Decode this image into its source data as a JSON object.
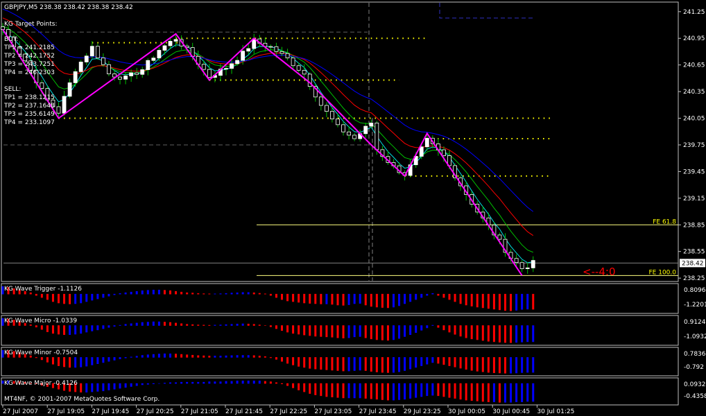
{
  "header": "GBPJPY,M5  238.38 238.42 238.38 238.42",
  "target_points": {
    "title": "KG Target Points:",
    "buy_label": "BUY:",
    "buy": [
      "TP1 = 241.2185",
      "TP2 = 242.1752",
      "TP3 = 243.7251",
      "TP4 = 246.2303"
    ],
    "sell_label": "SELL:",
    "sell": [
      "TP1 = 238.1215",
      "TP2 = 237.1648",
      "TP3 = 235.6149",
      "TP4 = 233.1097"
    ]
  },
  "annotation": "<--4:0",
  "copyright": "MT4NF, © 2001-2007 MetaQuotes Software Corp.",
  "colors": {
    "bull": "#ffffff",
    "bear": "#ffffff",
    "zigzag": "#ff00ff",
    "ma_blue": "#0000ff",
    "ma_red": "#ff0000",
    "ma_green": "#00c000",
    "ma_aqua": "#00e0e0",
    "target_dots": "#ffff00",
    "fib": "#ffff80",
    "grid": "#808080",
    "hist_red": "#ff0000",
    "hist_blue": "#0000ff",
    "annotation": "#ff0000"
  },
  "chart_data": [
    {
      "type": "candlestick",
      "title": "GBPJPY,M5",
      "ylim": [
        238.22,
        241.35
      ],
      "yticks": [
        241.25,
        240.95,
        240.65,
        240.35,
        240.05,
        239.75,
        239.45,
        239.15,
        238.85,
        238.55,
        238.25
      ],
      "current_price": 238.42,
      "xticks": [
        "27 Jul 2007",
        "27 Jul 19:05",
        "27 Jul 19:45",
        "27 Jul 20:25",
        "27 Jul 21:05",
        "27 Jul 21:45",
        "27 Jul 22:25",
        "27 Jul 23:05",
        "27 Jul 23:45",
        "29 Jul 23:25",
        "30 Jul 00:05",
        "30 Jul 00:45",
        "30 Jul 01:25"
      ],
      "zigzag": [
        [
          0,
          241.05
        ],
        [
          10,
          240.05
        ],
        [
          31,
          241.0
        ],
        [
          37,
          240.48
        ],
        [
          45,
          240.95
        ],
        [
          55,
          240.45
        ],
        [
          66,
          239.75
        ],
        [
          72,
          239.4
        ],
        [
          76,
          239.88
        ],
        [
          93,
          238.28
        ]
      ],
      "close_path": [
        [
          0,
          241.05
        ],
        [
          4,
          240.7
        ],
        [
          8,
          240.25
        ],
        [
          10,
          240.12
        ],
        [
          13,
          240.6
        ],
        [
          16,
          240.85
        ],
        [
          19,
          240.55
        ],
        [
          22,
          240.5
        ],
        [
          25,
          240.6
        ],
        [
          28,
          240.82
        ],
        [
          31,
          240.95
        ],
        [
          34,
          240.75
        ],
        [
          37,
          240.52
        ],
        [
          40,
          240.62
        ],
        [
          43,
          240.78
        ],
        [
          45,
          240.92
        ],
        [
          48,
          240.85
        ],
        [
          51,
          240.72
        ],
        [
          54,
          240.55
        ],
        [
          57,
          240.2
        ],
        [
          60,
          239.95
        ],
        [
          63,
          239.82
        ],
        [
          66,
          240.0
        ],
        [
          67,
          239.7
        ],
        [
          70,
          239.5
        ],
        [
          72,
          239.42
        ],
        [
          74,
          239.6
        ],
        [
          76,
          239.8
        ],
        [
          79,
          239.62
        ],
        [
          82,
          239.3
        ],
        [
          85,
          239.0
        ],
        [
          88,
          238.75
        ],
        [
          91,
          238.48
        ],
        [
          93,
          238.36
        ],
        [
          95,
          238.42
        ]
      ],
      "target_lines": [
        {
          "price": 240.9,
          "from": 16,
          "to": 32
        },
        {
          "price": 240.95,
          "from": 31,
          "to": 76
        },
        {
          "price": 240.48,
          "from": 37,
          "to": 71
        },
        {
          "price": 240.05,
          "from": 10,
          "to": 98
        },
        {
          "price": 239.82,
          "from": 76,
          "to": 98
        },
        {
          "price": 239.4,
          "from": 72,
          "to": 98
        }
      ],
      "fib_lines": [
        {
          "label": "FE 61.8",
          "price": 238.85
        },
        {
          "label": "FE 100.0",
          "price": 238.28
        }
      ]
    },
    {
      "type": "histogram",
      "title": "KG Wave Trigger",
      "value": "-1.1126",
      "yticks": [
        "0.8096",
        "-1.2201"
      ],
      "bar_count": 96,
      "bars": [
        0.55,
        0.5,
        0.4,
        0.3,
        0.2,
        0.1,
        -0.1,
        -0.25,
        -0.4,
        -0.55,
        -0.65,
        -0.7,
        -0.72,
        -0.7,
        -0.65,
        -0.55,
        -0.45,
        -0.35,
        -0.25,
        -0.15,
        -0.05,
        0.05,
        0.1,
        0.15,
        0.2,
        0.25,
        0.28,
        0.3,
        0.3,
        0.28,
        0.25,
        0.2,
        0.15,
        0.1,
        0.08,
        0.05,
        0.03,
        0.02,
        0.02,
        0.03,
        0.05,
        0.08,
        0.1,
        0.12,
        0.12,
        0.1,
        0.06,
        0.02,
        -0.1,
        -0.25,
        -0.4,
        -0.5,
        -0.55,
        -0.6,
        -0.65,
        -0.68,
        -0.7,
        -0.72,
        -0.72,
        -0.75,
        -0.8,
        -0.82,
        -0.78,
        -0.7,
        -0.68,
        -0.8,
        -0.9,
        -0.95,
        -0.98,
        -1.0,
        -0.95,
        -0.85,
        -0.7,
        -0.55,
        -0.4,
        -0.25,
        -0.1,
        0.05,
        -0.1,
        -0.25,
        -0.4,
        -0.55,
        -0.7,
        -0.8,
        -0.88,
        -0.95,
        -1.0,
        -1.05,
        -1.1,
        -1.15,
        -1.2,
        -1.22,
        -1.18,
        -1.12,
        -1.1,
        -1.11
      ]
    },
    {
      "type": "histogram",
      "title": "KG Wave Micro",
      "value": "-1.0339",
      "yticks": [
        "0.9124",
        "-1.0932"
      ],
      "bar_count": 96,
      "bars": [
        0.45,
        0.42,
        0.35,
        0.25,
        0.15,
        0.05,
        -0.1,
        -0.25,
        -0.4,
        -0.5,
        -0.55,
        -0.58,
        -0.58,
        -0.55,
        -0.5,
        -0.42,
        -0.35,
        -0.28,
        -0.2,
        -0.12,
        -0.05,
        0.02,
        0.08,
        0.12,
        0.16,
        0.2,
        0.22,
        0.24,
        0.24,
        0.22,
        0.2,
        0.16,
        0.12,
        0.08,
        0.06,
        0.04,
        0.03,
        0.02,
        0.03,
        0.04,
        0.06,
        0.08,
        0.1,
        0.11,
        0.1,
        0.08,
        0.04,
        0.0,
        -0.08,
        -0.2,
        -0.32,
        -0.42,
        -0.5,
        -0.55,
        -0.6,
        -0.64,
        -0.68,
        -0.7,
        -0.72,
        -0.74,
        -0.78,
        -0.8,
        -0.78,
        -0.72,
        -0.7,
        -0.78,
        -0.85,
        -0.9,
        -0.92,
        -0.94,
        -0.9,
        -0.82,
        -0.7,
        -0.58,
        -0.45,
        -0.3,
        -0.15,
        0.02,
        -0.12,
        -0.28,
        -0.42,
        -0.56,
        -0.68,
        -0.78,
        -0.85,
        -0.9,
        -0.95,
        -1.0,
        -1.03,
        -1.06,
        -1.08,
        -1.09,
        -1.07,
        -1.05,
        -1.03,
        -1.03
      ]
    },
    {
      "type": "histogram",
      "title": "KG Wave Minor",
      "value": "-0.7504",
      "yticks": [
        "0.7836",
        "-0.792"
      ],
      "bar_count": 96,
      "bars": [
        0.35,
        0.34,
        0.3,
        0.24,
        0.16,
        0.08,
        -0.02,
        -0.12,
        -0.24,
        -0.34,
        -0.42,
        -0.47,
        -0.5,
        -0.5,
        -0.48,
        -0.44,
        -0.38,
        -0.32,
        -0.26,
        -0.2,
        -0.14,
        -0.08,
        -0.03,
        0.02,
        0.06,
        0.1,
        0.13,
        0.15,
        0.17,
        0.18,
        0.18,
        0.17,
        0.15,
        0.13,
        0.11,
        0.09,
        0.08,
        0.07,
        0.07,
        0.07,
        0.08,
        0.09,
        0.1,
        0.1,
        0.1,
        0.09,
        0.07,
        0.04,
        -0.02,
        -0.1,
        -0.2,
        -0.3,
        -0.38,
        -0.45,
        -0.5,
        -0.55,
        -0.58,
        -0.6,
        -0.62,
        -0.64,
        -0.66,
        -0.68,
        -0.68,
        -0.66,
        -0.64,
        -0.66,
        -0.7,
        -0.73,
        -0.75,
        -0.76,
        -0.75,
        -0.72,
        -0.66,
        -0.58,
        -0.5,
        -0.42,
        -0.34,
        -0.26,
        -0.3,
        -0.36,
        -0.42,
        -0.48,
        -0.54,
        -0.6,
        -0.65,
        -0.69,
        -0.72,
        -0.75,
        -0.77,
        -0.78,
        -0.79,
        -0.79,
        -0.78,
        -0.76,
        -0.75,
        -0.75
      ]
    },
    {
      "type": "histogram",
      "title": "KG Wave Major",
      "value": "-0.4126",
      "yticks": [
        "0.0932",
        "-0.4358"
      ],
      "bar_count": 96,
      "bars": [
        0.06,
        0.06,
        0.05,
        0.04,
        0.03,
        0.01,
        -0.01,
        -0.04,
        -0.07,
        -0.1,
        -0.13,
        -0.16,
        -0.18,
        -0.19,
        -0.2,
        -0.2,
        -0.19,
        -0.18,
        -0.17,
        -0.15,
        -0.13,
        -0.11,
        -0.09,
        -0.07,
        -0.05,
        -0.03,
        -0.02,
        -0.01,
        0.0,
        0.01,
        0.02,
        0.02,
        0.03,
        0.03,
        0.03,
        0.03,
        0.03,
        0.04,
        0.04,
        0.04,
        0.05,
        0.05,
        0.06,
        0.06,
        0.06,
        0.06,
        0.06,
        0.05,
        0.04,
        0.02,
        -0.01,
        -0.05,
        -0.1,
        -0.15,
        -0.19,
        -0.23,
        -0.26,
        -0.28,
        -0.3,
        -0.31,
        -0.32,
        -0.33,
        -0.33,
        -0.33,
        -0.33,
        -0.34,
        -0.35,
        -0.36,
        -0.37,
        -0.38,
        -0.38,
        -0.37,
        -0.36,
        -0.34,
        -0.32,
        -0.3,
        -0.28,
        -0.27,
        -0.28,
        -0.3,
        -0.32,
        -0.34,
        -0.36,
        -0.38,
        -0.39,
        -0.4,
        -0.41,
        -0.42,
        -0.42,
        -0.43,
        -0.43,
        -0.43,
        -0.42,
        -0.42,
        -0.41,
        -0.41
      ]
    }
  ]
}
